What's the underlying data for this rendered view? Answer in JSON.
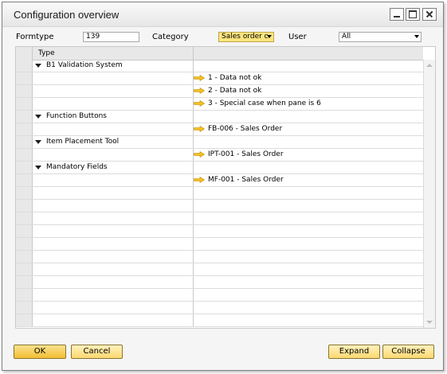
{
  "window": {
    "title": "Configuration overview"
  },
  "filters": {
    "formtype_label": "Formtype",
    "formtype_value": "139",
    "category_label": "Category",
    "category_value": "Sales order c",
    "user_label": "User",
    "user_value": "All"
  },
  "grid": {
    "column_type": "Type",
    "rows": [
      {
        "kind": "group",
        "label": "B1 Validation System"
      },
      {
        "kind": "item",
        "label": "1 - Data not ok"
      },
      {
        "kind": "item",
        "label": "2 - Data not ok"
      },
      {
        "kind": "item",
        "label": "3 - Special case when pane is 6"
      },
      {
        "kind": "group",
        "label": "Function Buttons"
      },
      {
        "kind": "item",
        "label": "FB-006 - Sales Order"
      },
      {
        "kind": "group",
        "label": "Item Placement Tool"
      },
      {
        "kind": "item",
        "label": "IPT-001 - Sales Order"
      },
      {
        "kind": "group",
        "label": "Mandatory Fields"
      },
      {
        "kind": "item",
        "label": "MF-001 - Sales Order"
      }
    ]
  },
  "buttons": {
    "ok": "OK",
    "cancel": "Cancel",
    "expand": "Expand",
    "collapse": "Collapse"
  },
  "colors": {
    "link_arrow": "#f6c21f",
    "button_face": "#fcd871"
  }
}
